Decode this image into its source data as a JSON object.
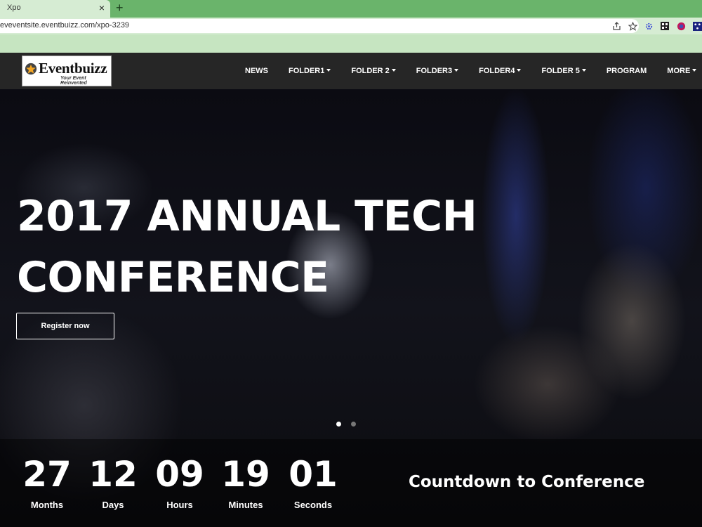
{
  "browser": {
    "tab_title": "Xpo",
    "tab_close": "×",
    "new_tab": "+",
    "url": "eveventsite.eventbuizz.com/xpo-3239"
  },
  "logo": {
    "name": "Eventbuizz",
    "tagline": "Your Event Reinvented"
  },
  "nav": {
    "items": [
      {
        "label": "NEWS",
        "dropdown": false
      },
      {
        "label": "FOLDER1",
        "dropdown": true
      },
      {
        "label": "FOLDER 2",
        "dropdown": true
      },
      {
        "label": "FOLDER3",
        "dropdown": true
      },
      {
        "label": "FOLDER4",
        "dropdown": true
      },
      {
        "label": "FOLDER 5",
        "dropdown": true
      },
      {
        "label": "PROGRAM",
        "dropdown": false
      },
      {
        "label": "MORE",
        "dropdown": true
      }
    ]
  },
  "hero": {
    "title_line1": "2017 ANNUAL TECH",
    "title_line2": "CONFERENCE",
    "register_label": "Register now",
    "slides": 2,
    "active_slide": 1
  },
  "countdown": {
    "title": "Countdown to Conference",
    "units": [
      {
        "value": "27",
        "label": "Months"
      },
      {
        "value": "12",
        "label": "Days"
      },
      {
        "value": "09",
        "label": "Hours"
      },
      {
        "value": "19",
        "label": "Minutes"
      },
      {
        "value": "01",
        "label": "Seconds"
      }
    ]
  },
  "colors": {
    "tabbar": "#6ab46b",
    "toolbar": "#d6ecd3",
    "nav_bg": "#262626",
    "text": "#ffffff"
  }
}
